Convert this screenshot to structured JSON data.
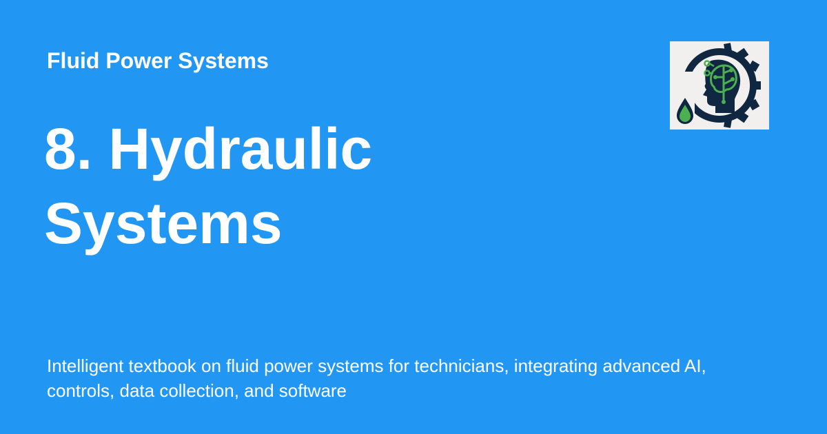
{
  "header": {
    "site_name": "Fluid Power Systems",
    "logo_icon": "ai-head-gear-oil-drop-icon"
  },
  "main": {
    "title": "8. Hydraulic Systems",
    "description": "Intelligent textbook on fluid power systems for technicians, integrating advanced AI, controls, data collection, and software"
  },
  "colors": {
    "background": "#2196f3",
    "text": "#ffffff",
    "logo_background": "#f2f0ee",
    "logo_navy": "#0f2740",
    "logo_green": "#4caf50"
  }
}
